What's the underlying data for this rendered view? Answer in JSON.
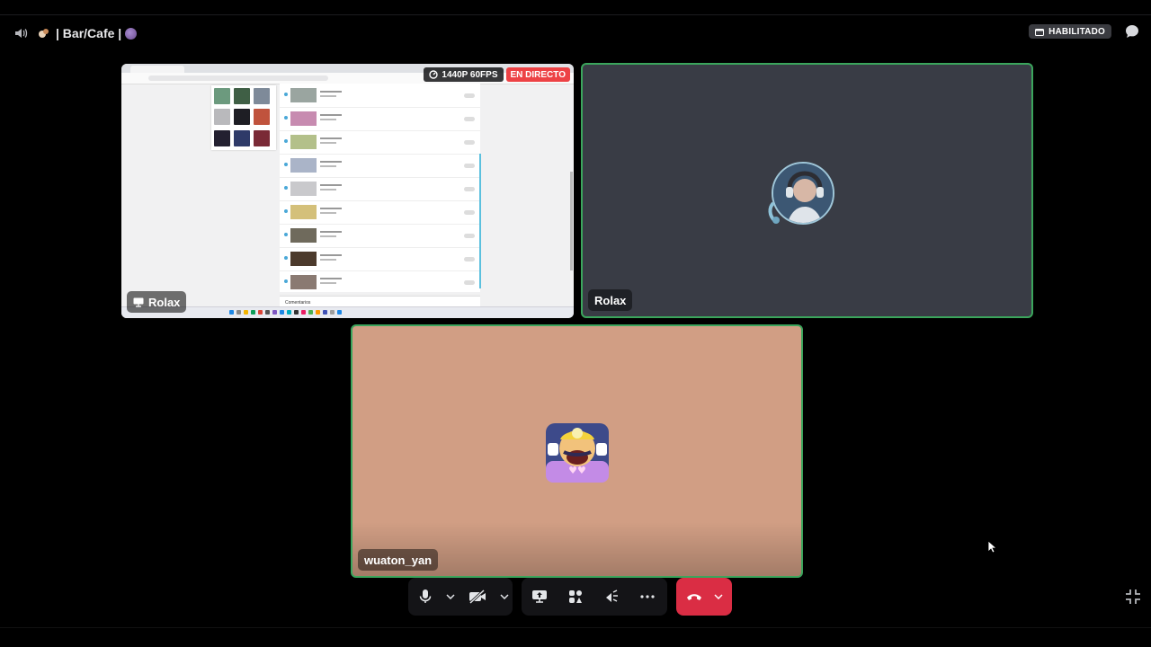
{
  "header": {
    "channel_name": "| Bar/Cafe |",
    "status_badge": "HABILITADO"
  },
  "stream": {
    "quality": "1440P 60FPS",
    "live_label": "EN DIRECTO",
    "comments_label": "Comentarios",
    "username": "Rolax"
  },
  "participants": [
    {
      "username": "Rolax"
    },
    {
      "username": "wuaton_yan"
    }
  ],
  "colors": {
    "speaking_border": "#3ba55c",
    "hangup": "#da2d44",
    "live": "#ed4245"
  },
  "icons": {
    "header": [
      "speaker-icon",
      "emoji-icon",
      "chat-bubble-icon"
    ],
    "controls": [
      "microphone-icon",
      "camera-off-icon",
      "screen-share-icon",
      "activities-icon",
      "soundboard-icon",
      "more-icon",
      "hangup-icon",
      "exit-fullscreen-icon"
    ]
  }
}
